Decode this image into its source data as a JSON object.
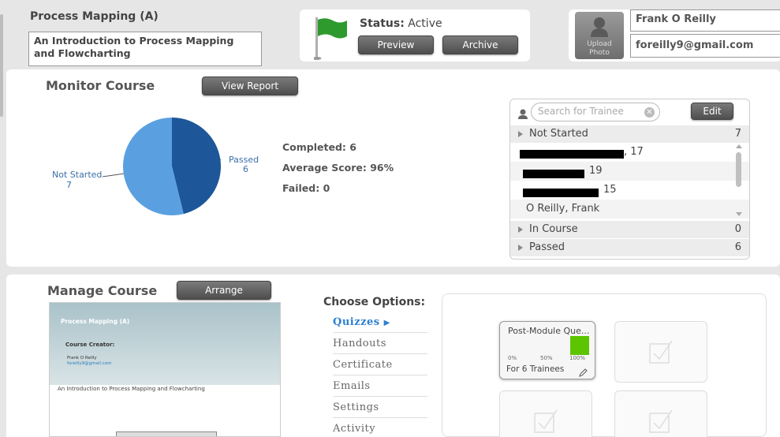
{
  "course": {
    "title": "Process Mapping (A)",
    "description": "An Introduction to Process Mapping and Flowcharting",
    "status_label": "Status:",
    "status_value": "Active",
    "preview_label": "Preview",
    "archive_label": "Archive"
  },
  "user": {
    "upload_label_1": "Upload",
    "upload_label_2": "Photo",
    "name": "Frank O Reilly",
    "email": "foreilly9@gmail.com"
  },
  "monitor": {
    "title": "Monitor Course",
    "view_report_label": "View Report",
    "stats": {
      "completed": "Completed: 6",
      "average": "Average Score: 96%",
      "failed": "Failed: 0"
    },
    "pie_labels": {
      "not_started_name": "Not Started",
      "not_started_value": "7",
      "passed_name": "Passed",
      "passed_value": "6"
    },
    "colors": {
      "not_started": "#5aa0e0",
      "passed": "#1d5799"
    }
  },
  "chart_data": {
    "type": "pie",
    "categories": [
      "Not Started",
      "Passed"
    ],
    "values": [
      7,
      6
    ]
  },
  "trainees": {
    "search_placeholder": "Search for Trainee",
    "edit_label": "Edit",
    "groups": [
      {
        "label": "Not Started",
        "count": "7"
      },
      {
        "label": "In Course",
        "count": "0"
      },
      {
        "label": "Passed",
        "count": "6"
      }
    ],
    "not_started_rows": [
      ", 17",
      "19",
      "15",
      "O Reilly, Frank"
    ]
  },
  "manage": {
    "title": "Manage Course",
    "arrange_label": "Arrange",
    "preview_card": {
      "title": "Process Mapping (A)",
      "creator_label": "Course Creator:",
      "creator_name": "Frank O Reilly",
      "creator_email": "foreilly9@gmail.com",
      "description": "An Introduction to Process Mapping and Flowcharting"
    },
    "choose_title": "Choose Options:",
    "options": [
      "Quizzes",
      "Handouts",
      "Certificate",
      "Emails",
      "Settings",
      "Activity"
    ],
    "active_option": "Quizzes",
    "quiz_card": {
      "title": "Post-Module Que...",
      "scale": [
        "0%",
        "50%",
        "100%"
      ],
      "trainees": "For 6 Trainees",
      "progress": 1.0,
      "progress_color": "#5cc400"
    }
  }
}
